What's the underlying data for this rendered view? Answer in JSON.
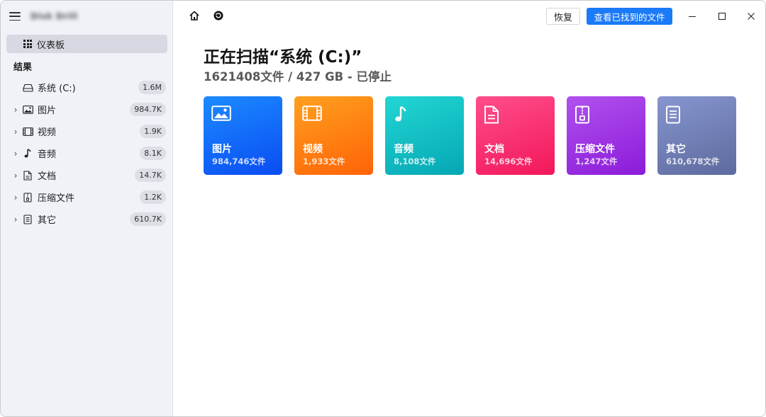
{
  "app": {
    "name": "Disk Drill"
  },
  "sidebar": {
    "dashboard_label": "仪表板",
    "section_title": "结果",
    "items": [
      {
        "label": "系统 (C:)",
        "badge": "1.6M",
        "icon": "drive-icon",
        "expandable": false
      },
      {
        "label": "图片",
        "badge": "984.7K",
        "icon": "image-icon",
        "expandable": true
      },
      {
        "label": "视频",
        "badge": "1.9K",
        "icon": "film-icon",
        "expandable": true
      },
      {
        "label": "音频",
        "badge": "8.1K",
        "icon": "music-note-icon",
        "expandable": true
      },
      {
        "label": "文档",
        "badge": "14.7K",
        "icon": "document-icon",
        "expandable": true
      },
      {
        "label": "压缩文件",
        "badge": "1.2K",
        "icon": "archive-icon",
        "expandable": true
      },
      {
        "label": "其它",
        "badge": "610.7K",
        "icon": "other-file-icon",
        "expandable": true
      }
    ],
    "chevron": "›"
  },
  "toolbar": {
    "home_icon": "home-icon",
    "history_icon": "history-icon",
    "restore_label": "恢复",
    "found_files_label": "查看已找到的文件"
  },
  "window_controls": {
    "minimize": "minimize-icon",
    "maximize": "maximize-icon",
    "close": "close-icon"
  },
  "main": {
    "title": "正在扫描“系统 (C:)”",
    "subtitle": "1621408文件 / 427 GB - 已停止",
    "cards": [
      {
        "name": "图片",
        "count": "984,746文件",
        "icon": "image-icon",
        "color_from": "#1c8bff",
        "color_to": "#0a4cf2"
      },
      {
        "name": "视频",
        "count": "1,933文件",
        "icon": "film-icon",
        "color_from": "#ffa01e",
        "color_to": "#ff6307"
      },
      {
        "name": "音频",
        "count": "8,108文件",
        "icon": "music-note-icon",
        "color_from": "#22d6d3",
        "color_to": "#05a7b4"
      },
      {
        "name": "文档",
        "count": "14,696文件",
        "icon": "document-icon",
        "color_from": "#ff4e8b",
        "color_to": "#f2175a"
      },
      {
        "name": "压缩文件",
        "count": "1,247文件",
        "icon": "archive-icon",
        "color_from": "#b151ee",
        "color_to": "#8b1bd9"
      },
      {
        "name": "其它",
        "count": "610,678文件",
        "icon": "other-file-icon",
        "color_from": "#8796d0",
        "color_to": "#5d6a9e"
      }
    ]
  },
  "colors": {
    "accent": "#1a7af8",
    "sidebar_bg": "#f0f2f8",
    "selected_bg": "#d6d9e1"
  }
}
